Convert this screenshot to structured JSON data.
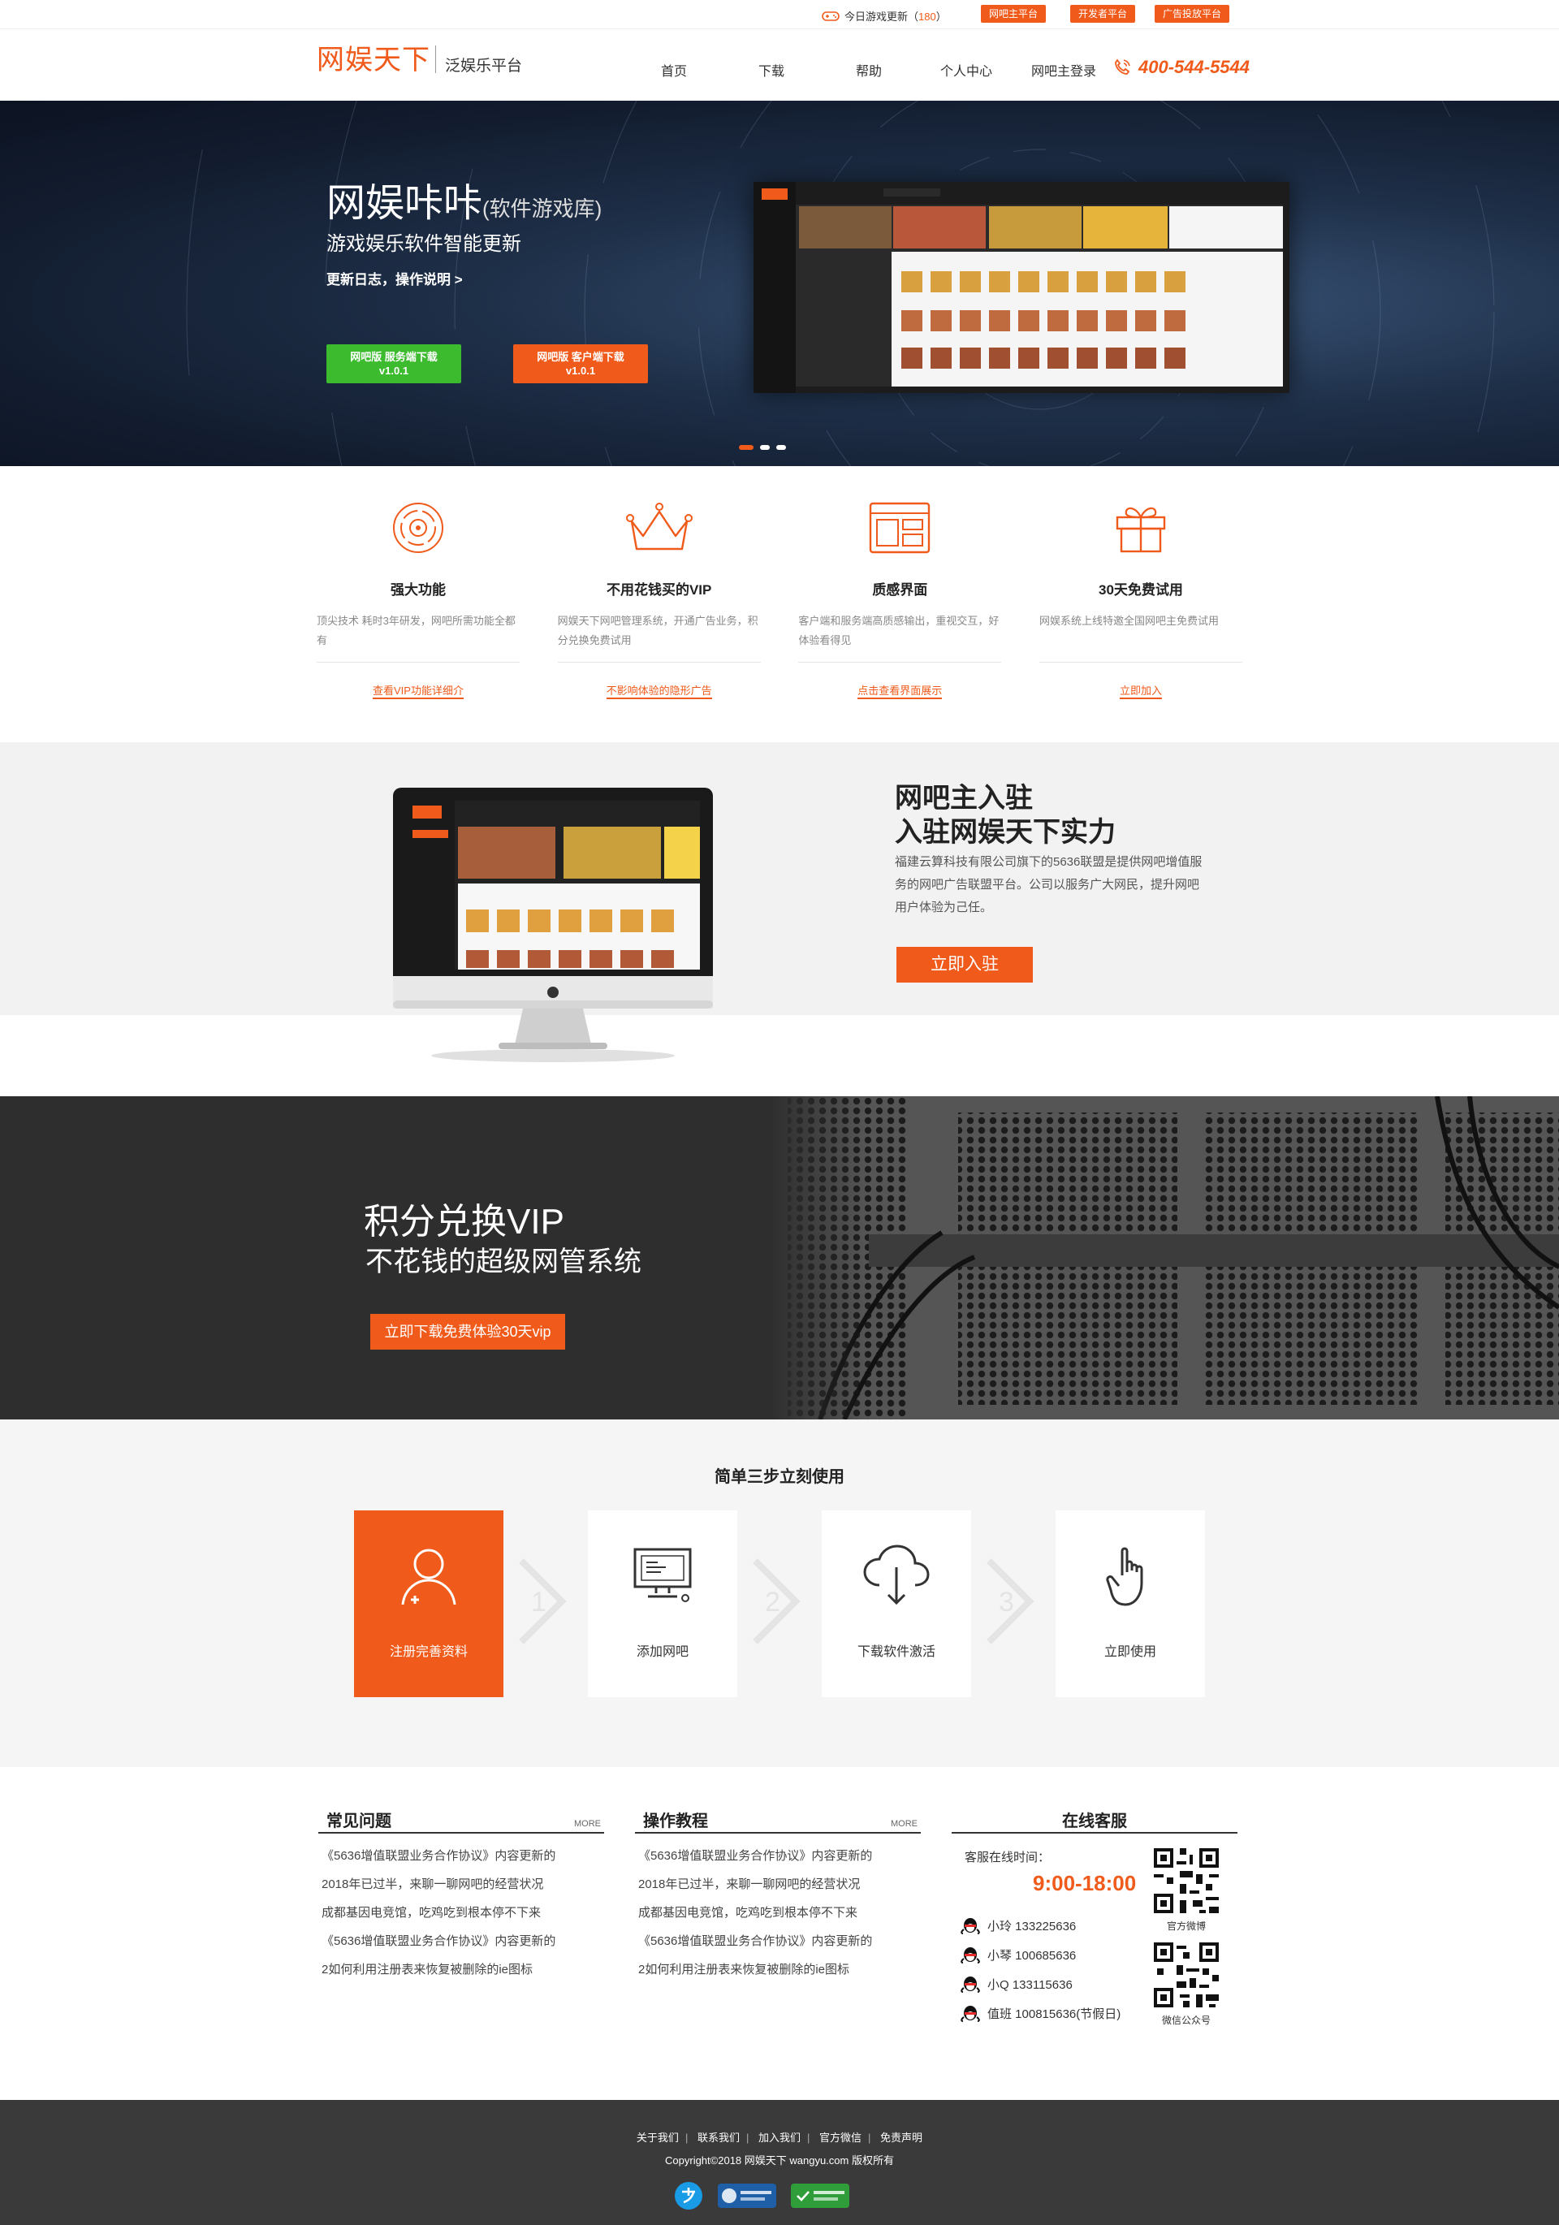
{
  "topbar": {
    "update_label": "今日游戏更新（",
    "update_count": "180",
    "update_close": "）",
    "links": [
      "网吧主平台",
      "开发者平台",
      "广告投放平台"
    ]
  },
  "header": {
    "logo": "网娱天下",
    "slogan": "泛娱乐平台",
    "nav": [
      "首页",
      "下载",
      "帮助",
      "个人中心",
      "网吧主登录"
    ],
    "phone": "400-544-5544"
  },
  "hero": {
    "title": "网娱咔咔",
    "title_note": "(软件游戏库)",
    "subtitle": "游戏娱乐软件智能更新",
    "link": "更新日志，操作说明 >",
    "btn_server_line1": "网吧版 服务端下载",
    "btn_server_line2": "v1.0.1",
    "btn_client_line1": "网吧版 客户端下载",
    "btn_client_line2": "v1.0.1"
  },
  "features": [
    {
      "icon": "target-icon",
      "title": "强大功能",
      "desc": "顶尖技术 耗时3年研发，网吧所需功能全都有",
      "link": "查看VIP功能详细介"
    },
    {
      "icon": "crown-icon",
      "title": "不用花钱买的VIP",
      "desc": "网娱天下网吧管理系统，开通广告业务，积分兑换免费试用",
      "link": "不影响体验的隐形广告"
    },
    {
      "icon": "window-icon",
      "title": "质感界面",
      "desc": "客户端和服务端高质感输出，重视交互，好体验看得见",
      "link": "点击查看界面展示"
    },
    {
      "icon": "gift-icon",
      "title": "30天免费试用",
      "desc": "网娱系统上线特邀全国网吧主免费试用",
      "link": "立即加入"
    }
  ],
  "join": {
    "title_line1": "网吧主入驻",
    "title_line2": "入驻网娱天下实力",
    "desc": "福建云算科技有限公司旗下的5636联盟是提供网吧增值服务的网吧广告联盟平台。公司以服务广大网民，提升网吧用户体验为己任。",
    "button": "立即入驻"
  },
  "vip": {
    "title": "积分兑换VIP",
    "subtitle": "不花钱的超级网管系统",
    "button": "立即下载免费体验30天vip"
  },
  "steps": {
    "title": "简单三步立刻使用",
    "items": [
      {
        "icon": "user-icon",
        "label": "注册完善资料"
      },
      {
        "icon": "computer-icon",
        "label": "添加网吧"
      },
      {
        "icon": "cloud-download-icon",
        "label": "下载软件激活"
      },
      {
        "icon": "hand-pointer-icon",
        "label": "立即使用"
      }
    ],
    "arrows": [
      "1",
      "2",
      "3"
    ]
  },
  "faq": {
    "title": "常见问题",
    "more": "MORE",
    "items": [
      "《5636增值联盟业务合作协议》内容更新的",
      "2018年已过半，来聊一聊网吧的经营状况",
      "成都基因电竞馆，吃鸡吃到根本停不下来",
      "《5636增值联盟业务合作协议》内容更新的",
      "2如何利用注册表来恢复被删除的ie图标"
    ]
  },
  "tutorial": {
    "title": "操作教程",
    "more": "MORE",
    "items": [
      "《5636增值联盟业务合作协议》内容更新的",
      "2018年已过半，来聊一聊网吧的经营状况",
      "成都基因电竞馆，吃鸡吃到根本停不下来",
      "《5636增值联盟业务合作协议》内容更新的",
      "2如何利用注册表来恢复被删除的ie图标"
    ]
  },
  "service": {
    "title": "在线客服",
    "time_label": "客服在线时间：",
    "time": "9:00-18:00",
    "contacts": [
      "小玲 133225636",
      "小琴 100685636",
      "小Q 133115636",
      "值班 100815636(节假日)"
    ],
    "qr_weibo": "官方微博",
    "qr_wechat": "微信公众号"
  },
  "footer": {
    "links": [
      "关于我们",
      "联系我们",
      "加入我们",
      "官方微信",
      "免责声明"
    ],
    "copyright": "Copyright©2018 网娱天下 wangyu.com 版权所有"
  },
  "colors": {
    "accent": "#f05a1a",
    "green": "#3dbb2f",
    "dark": "#2e2e2e",
    "footer": "#3a3a3a"
  }
}
